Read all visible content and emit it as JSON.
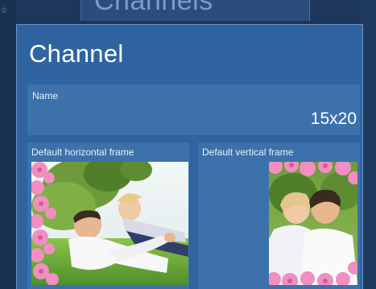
{
  "background": {
    "title": "Channels"
  },
  "dialog": {
    "title": "Channel",
    "name": {
      "label": "Name",
      "value": "15x20"
    },
    "horizontal_frame": {
      "label": "Default horizontal frame"
    },
    "vertical_frame": {
      "label": "Default vertical frame"
    }
  },
  "colors": {
    "dialog_bg": "#2f64a0",
    "field_bg": "#3d71ab",
    "frame_flowers": "#f08fc0"
  }
}
